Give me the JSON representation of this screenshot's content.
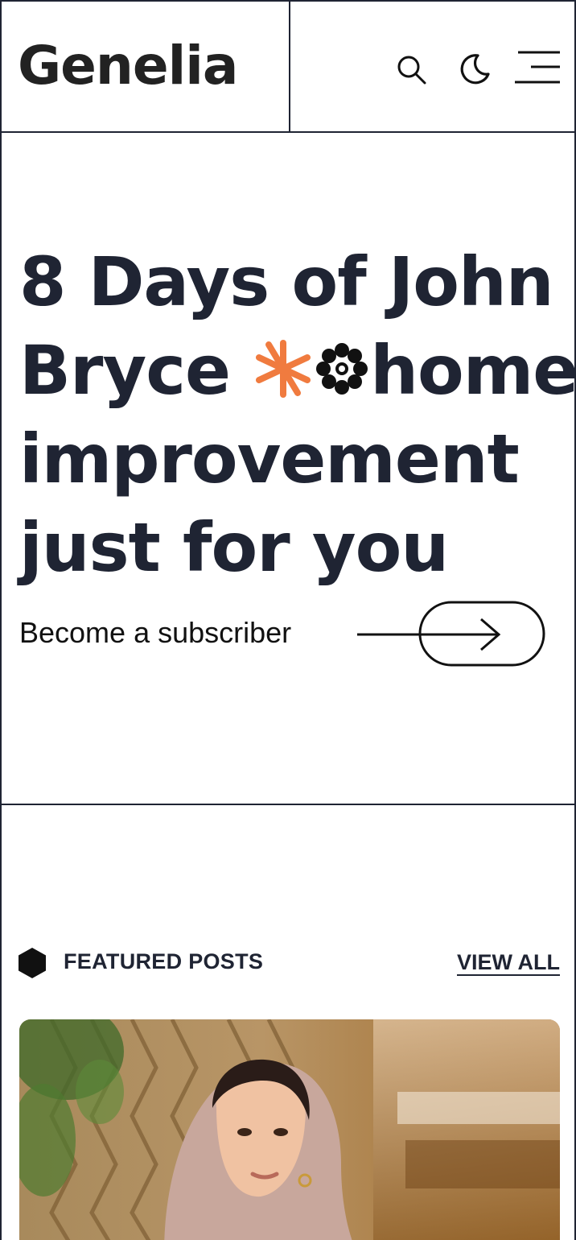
{
  "header": {
    "logo_text": "Genelia",
    "icons": [
      "search-icon",
      "moon-icon",
      "menu-icon"
    ]
  },
  "hero": {
    "title_line1": "8 Days of John",
    "title_line2_pre": "Bryce ",
    "title_line2_post": "home",
    "title_line3": "improvement",
    "title_line4": "just for you",
    "decorations": [
      "asterisk-icon",
      "flower-icon"
    ],
    "subscribe_label": "Become a subscriber",
    "subscribe_icon": "arrow-right-icon"
  },
  "featured": {
    "title": "FEATURED POSTS",
    "view_all_label": "VIEW ALL",
    "marker_icon": "hexagon-icon"
  },
  "colors": {
    "text": "#1f2433",
    "accent": "#f07b3f",
    "background": "#ffffff"
  }
}
